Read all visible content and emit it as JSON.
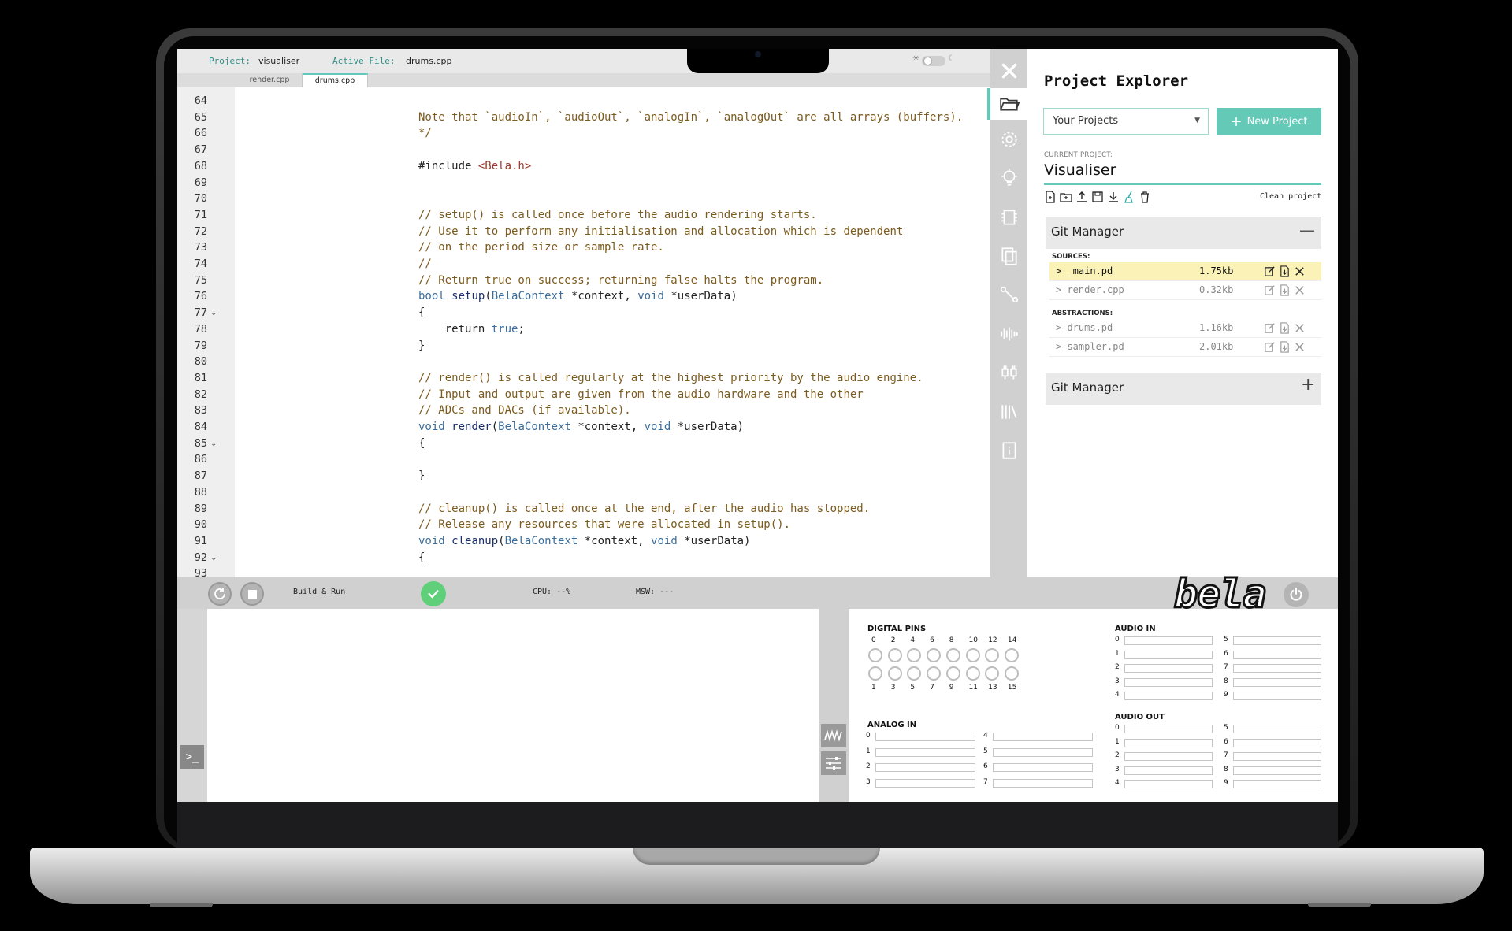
{
  "topbar": {
    "project_label": "Project:",
    "project_value": "visualiser",
    "active_file_label": "Active File:",
    "active_file_value": "drums.cpp"
  },
  "tabs": [
    {
      "label": "render.cpp",
      "active": false
    },
    {
      "label": "drums.cpp",
      "active": true
    }
  ],
  "editor": {
    "lines": [
      {
        "n": "64",
        "text": "",
        "cls": ""
      },
      {
        "n": "65",
        "text": "Note that `audioIn`, `audioOut`, `analogIn`, `analogOut` are all arrays (buffers).",
        "cls": "cmt"
      },
      {
        "n": "66",
        "text": "*/",
        "cls": "cmt"
      },
      {
        "n": "67",
        "text": "",
        "cls": ""
      },
      {
        "n": "68",
        "text": "#include <Bela.h>",
        "cls": "inc"
      },
      {
        "n": "69",
        "text": "",
        "cls": ""
      },
      {
        "n": "70",
        "text": "",
        "cls": ""
      },
      {
        "n": "71",
        "text": "// setup() is called once before the audio rendering starts.",
        "cls": "cmt"
      },
      {
        "n": "72",
        "text": "// Use it to perform any initialisation and allocation which is dependent",
        "cls": "cmt"
      },
      {
        "n": "73",
        "text": "// on the period size or sample rate.",
        "cls": "cmt"
      },
      {
        "n": "74",
        "text": "//",
        "cls": "cmt"
      },
      {
        "n": "75",
        "text": "// Return true on success; returning false halts the program.",
        "cls": "cmt"
      },
      {
        "n": "76",
        "text": "bool setup(BelaContext *context, void *userData)",
        "cls": "sig"
      },
      {
        "n": "77",
        "text": "{",
        "cls": "",
        "fold": true
      },
      {
        "n": "78",
        "text": "    return true;",
        "cls": "ret"
      },
      {
        "n": "79",
        "text": "}",
        "cls": ""
      },
      {
        "n": "80",
        "text": "",
        "cls": ""
      },
      {
        "n": "81",
        "text": "// render() is called regularly at the highest priority by the audio engine.",
        "cls": "cmt"
      },
      {
        "n": "82",
        "text": "// Input and output are given from the audio hardware and the other",
        "cls": "cmt"
      },
      {
        "n": "83",
        "text": "// ADCs and DACs (if available).",
        "cls": "cmt"
      },
      {
        "n": "84",
        "text": "void render(BelaContext *context, void *userData)",
        "cls": "sig"
      },
      {
        "n": "85",
        "text": "{",
        "cls": "",
        "fold": true
      },
      {
        "n": "86",
        "text": "",
        "cls": ""
      },
      {
        "n": "87",
        "text": "}",
        "cls": ""
      },
      {
        "n": "88",
        "text": "",
        "cls": ""
      },
      {
        "n": "89",
        "text": "// cleanup() is called once at the end, after the audio has stopped.",
        "cls": "cmt"
      },
      {
        "n": "90",
        "text": "// Release any resources that were allocated in setup().",
        "cls": "cmt"
      },
      {
        "n": "91",
        "text": "void cleanup(BelaContext *context, void *userData)",
        "cls": "sig"
      },
      {
        "n": "92",
        "text": "{",
        "cls": "",
        "fold": true
      },
      {
        "n": "93",
        "text": "",
        "cls": ""
      }
    ]
  },
  "sidebar": {
    "icons": [
      "close-icon",
      "folder-icon",
      "gear-icon",
      "lightbulb-icon",
      "chip-icon",
      "files-icon",
      "pipeline-icon",
      "waveform-icon",
      "pins-icon",
      "library-icon",
      "manual-icon"
    ]
  },
  "explorer": {
    "title": "Project Explorer",
    "select_value": "Your Projects",
    "new_project_label": "New Project",
    "current_label": "CURRENT PROJECT:",
    "current_name": "Visualiser",
    "clean_label": "Clean project",
    "git_title_1": "Git Manager",
    "git_title_2": "Git Manager",
    "sources_label": "SOURCES:",
    "abstractions_label": "ABSTRACTIONS:",
    "sources": [
      {
        "name": "> _main.pd",
        "size": "1.75kb",
        "highlight": true
      },
      {
        "name": "> render.cpp",
        "size": "0.32kb",
        "highlight": false
      }
    ],
    "abstractions": [
      {
        "name": "> drums.pd",
        "size": "1.16kb",
        "highlight": false
      },
      {
        "name": "> sampler.pd",
        "size": "2.01kb",
        "highlight": false
      }
    ]
  },
  "toolbar": {
    "build_label": "Build & Run",
    "cpu_label": "CPU: --%",
    "msw_label": "MSW: ---",
    "logo_text": "bela"
  },
  "console": {
    "prompt_label": ">_"
  },
  "io": {
    "digital_title": "DIGITAL PINS",
    "digital_top": [
      "0",
      "2",
      "4",
      "6",
      "8",
      "10",
      "12",
      "14"
    ],
    "digital_bottom": [
      "1",
      "3",
      "5",
      "7",
      "9",
      "11",
      "13",
      "15"
    ],
    "analog_in_title": "ANALOG IN",
    "analog_in_left": [
      "0",
      "1",
      "2",
      "3"
    ],
    "analog_in_right": [
      "4",
      "5",
      "6",
      "7"
    ],
    "audio_in_title": "AUDIO IN",
    "audio_in_left": [
      "0",
      "1",
      "2",
      "3",
      "4"
    ],
    "audio_in_right": [
      "5",
      "6",
      "7",
      "8",
      "9"
    ],
    "audio_out_title": "AUDIO OUT",
    "audio_out_left": [
      "0",
      "1",
      "2",
      "3",
      "4"
    ],
    "audio_out_right": [
      "5",
      "6",
      "7",
      "8",
      "9"
    ]
  },
  "colors": {
    "accent": "#64c9b7",
    "ok_green": "#5fcf7a",
    "highlight_row": "#fbf2b7"
  }
}
